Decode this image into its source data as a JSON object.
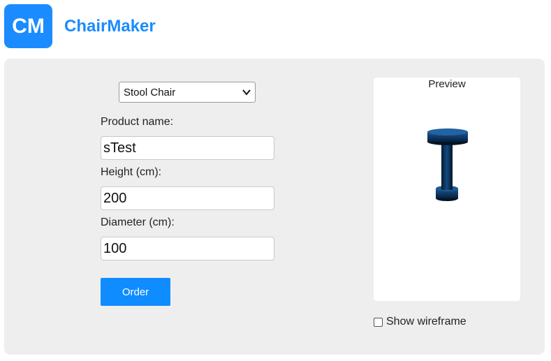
{
  "header": {
    "logo_text": "CM",
    "brand": "ChairMaker"
  },
  "form": {
    "chair_type": "Stool Chair",
    "product_name_label": "Product name:",
    "product_name_value": "sTest",
    "height_label": "Height (cm):",
    "height_value": "200",
    "diameter_label": "Diameter (cm):",
    "diameter_value": "100",
    "order_label": "Order"
  },
  "preview": {
    "title": "Preview",
    "wireframe_label": "Show wireframe",
    "wireframe_checked": false,
    "model_color": "#0d3a66"
  },
  "colors": {
    "accent": "#1a8cff",
    "panel": "#eeeeee"
  }
}
